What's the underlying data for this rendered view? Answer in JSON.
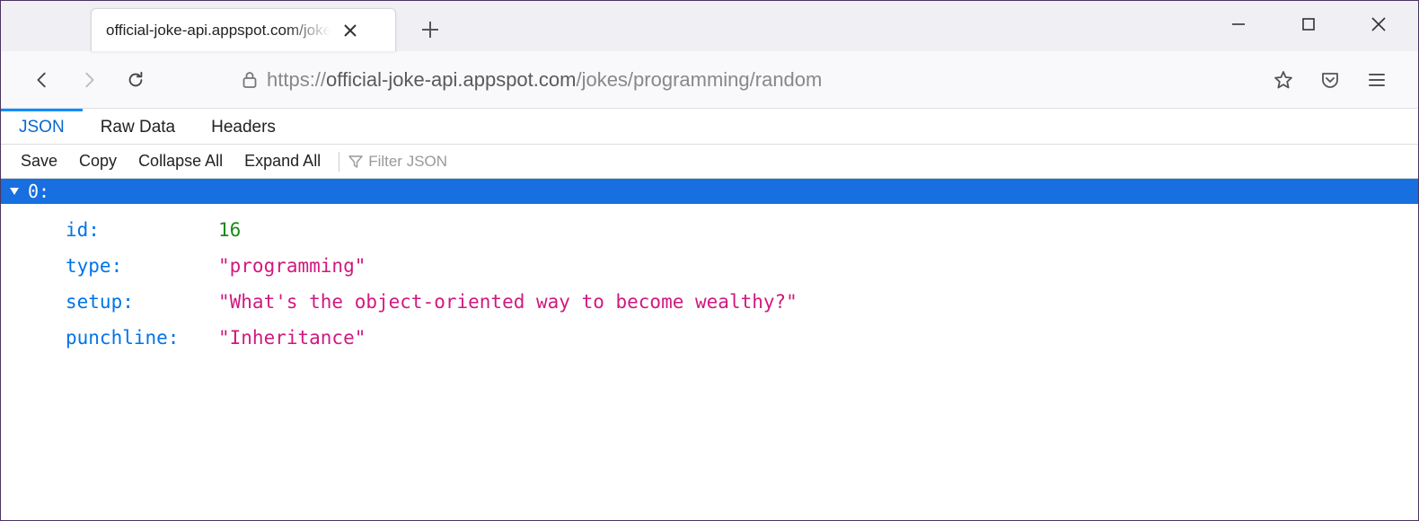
{
  "tab": {
    "title": "official-joke-api.appspot.com/jokes/programming/random"
  },
  "window": {
    "minimize_label": "Minimize",
    "maximize_label": "Maximize",
    "close_label": "Close"
  },
  "url": {
    "scheme": "https://",
    "host": "official-joke-api.appspot.com",
    "path": "/jokes/programming/random"
  },
  "json_viewer": {
    "tabs": {
      "json": "JSON",
      "raw": "Raw Data",
      "headers": "Headers"
    },
    "actions": {
      "save": "Save",
      "copy": "Copy",
      "collapse": "Collapse All",
      "expand": "Expand All"
    },
    "filter_placeholder": "Filter JSON",
    "root_index_label": "0:"
  },
  "json_payload": {
    "keys": {
      "id": "id:",
      "type": "type:",
      "setup": "setup:",
      "punchline": "punchline:"
    },
    "values": {
      "id": "16",
      "type": "\"programming\"",
      "setup": "\"What's the object-oriented way to become wealthy?\"",
      "punchline": "\"Inheritance\""
    }
  }
}
